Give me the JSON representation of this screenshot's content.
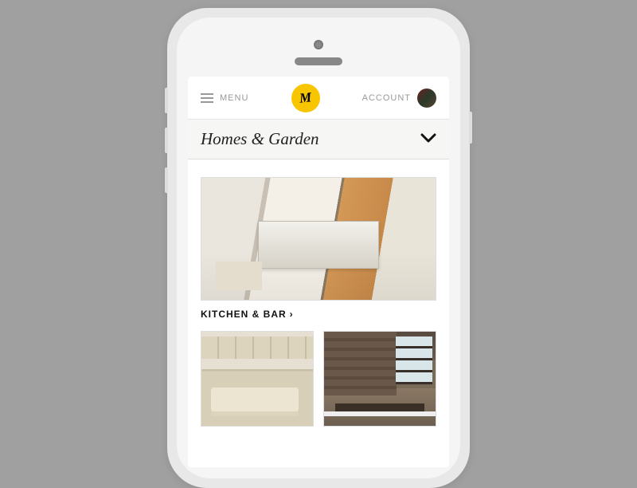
{
  "header": {
    "menu_label": "MENU",
    "account_label": "ACCOUNT",
    "logo_text": "M"
  },
  "category": {
    "title": "Homes & Garden"
  },
  "section": {
    "label": "KITCHEN & BAR",
    "chevron": "›"
  }
}
